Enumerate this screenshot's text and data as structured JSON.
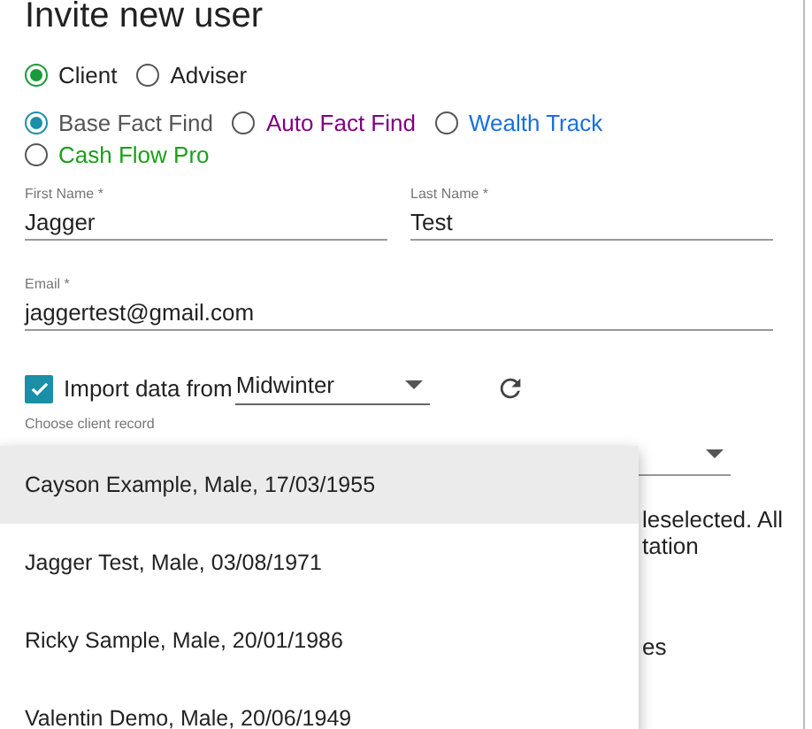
{
  "dialog": {
    "title": "Invite new user"
  },
  "user_types": [
    {
      "label": "Client",
      "selected": true
    },
    {
      "label": "Adviser",
      "selected": false
    }
  ],
  "products": [
    {
      "label": "Base Fact Find",
      "selected": true,
      "color": "#555555"
    },
    {
      "label": "Auto Fact Find",
      "selected": false,
      "color": "#800080"
    },
    {
      "label": "Wealth Track",
      "selected": false,
      "color": "#1a6fe0"
    },
    {
      "label": "Cash Flow Pro",
      "selected": false,
      "color": "#1aa01a"
    }
  ],
  "first_name": {
    "label": "First Name *",
    "value": "Jagger"
  },
  "last_name": {
    "label": "Last Name *",
    "value": "Test"
  },
  "email": {
    "label": "Email *",
    "value": "jaggertest@gmail.com"
  },
  "import": {
    "checked": true,
    "label": "Import data from",
    "source": "Midwinter"
  },
  "client_record": {
    "label": "Choose client record"
  },
  "hidden_text": [
    "leselected. All",
    "tation",
    "es"
  ],
  "menu": [
    {
      "label": "Cayson Example, Male, 17/03/1955",
      "selected": true
    },
    {
      "label": "Jagger Test, Male, 03/08/1971",
      "selected": false
    },
    {
      "label": "Ricky Sample, Male, 20/01/1986",
      "selected": false
    },
    {
      "label": "Valentin Demo, Male, 20/06/1949",
      "selected": false
    }
  ]
}
